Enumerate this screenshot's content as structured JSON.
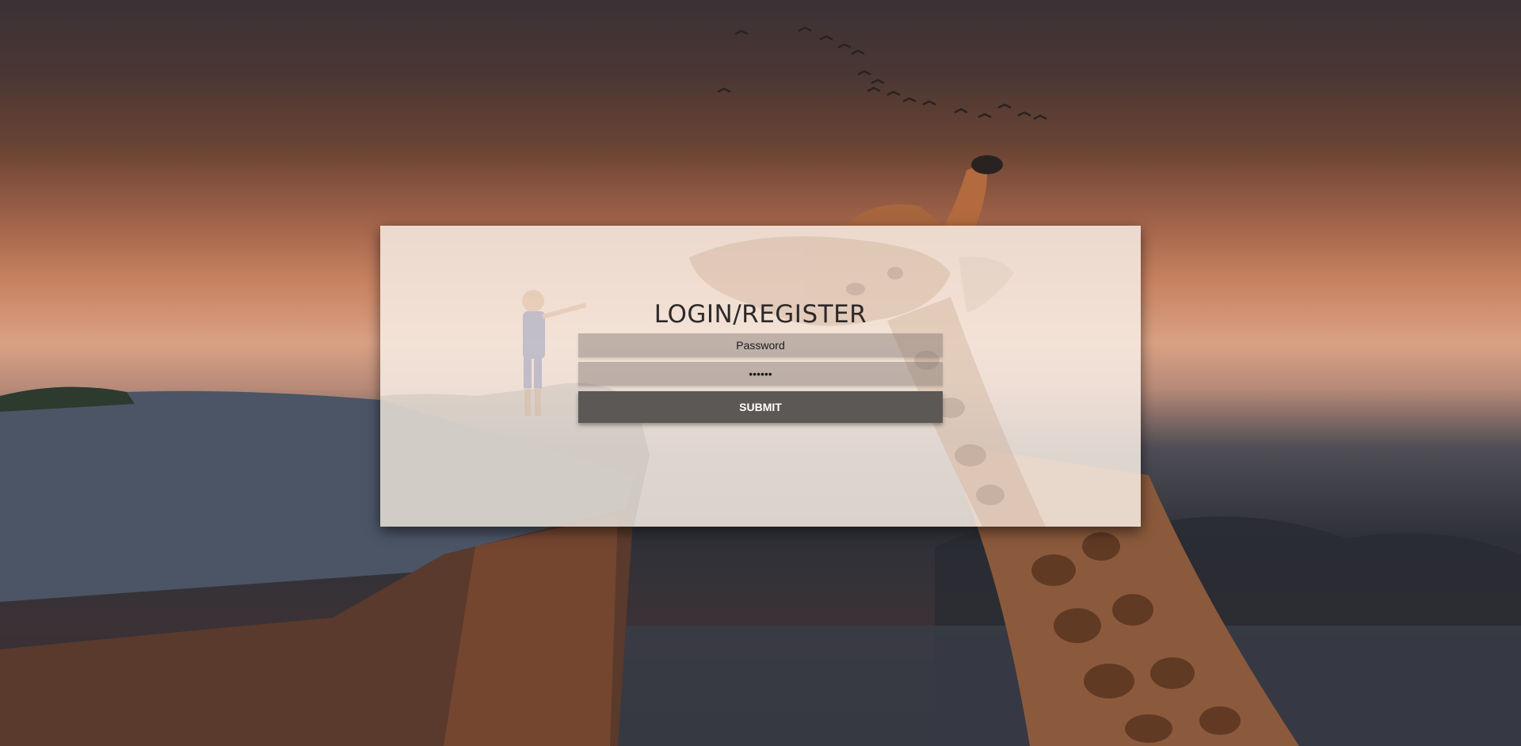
{
  "page": {
    "title": "LOGIN/REGISTER"
  },
  "form": {
    "password_placeholder": "Password",
    "password_value": "",
    "confirm_value": "••••••",
    "submit_label": "SUBMIT"
  },
  "background": {
    "scene": "giraffe-and-child-on-cliff-photo"
  },
  "colors": {
    "panel": "#f7ece4",
    "button": "#5c5856",
    "title": "#2d2a29"
  }
}
